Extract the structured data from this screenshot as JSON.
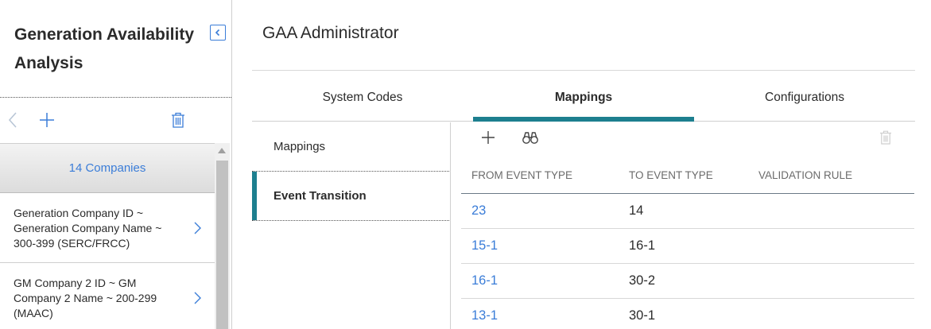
{
  "sidebar": {
    "title": "Generation Availability Analysis",
    "companies_count": "14 Companies",
    "companies": [
      {
        "label": "Generation Company ID ~ Generation Company Name ~ 300-399 (SERC/FRCC)"
      },
      {
        "label": "GM Company 2 ID ~ GM Company 2 Name ~ 200-299 (MAAC)"
      }
    ],
    "icons": {
      "collapse": "collapse-icon",
      "back": "chevron-left-icon",
      "add": "plus-icon",
      "delete": "trash-icon"
    }
  },
  "main": {
    "title": "GAA Administrator",
    "tabs": [
      {
        "label": "System Codes",
        "active": false
      },
      {
        "label": "Mappings",
        "active": true
      },
      {
        "label": "Configurations",
        "active": false
      }
    ],
    "subnav": [
      {
        "label": "Mappings",
        "active": false
      },
      {
        "label": "Event Transition",
        "active": true
      }
    ],
    "table": {
      "headers": [
        "FROM EVENT TYPE",
        "TO EVENT TYPE",
        "VALIDATION RULE"
      ],
      "rows": [
        {
          "from": "23",
          "to": "14",
          "rule": ""
        },
        {
          "from": "15-1",
          "to": "16-1",
          "rule": ""
        },
        {
          "from": "16-1",
          "to": "30-2",
          "rule": ""
        },
        {
          "from": "13-1",
          "to": "30-1",
          "rule": ""
        }
      ]
    }
  },
  "colors": {
    "accent": "#1d7f8f",
    "link": "#3b7dd8"
  }
}
